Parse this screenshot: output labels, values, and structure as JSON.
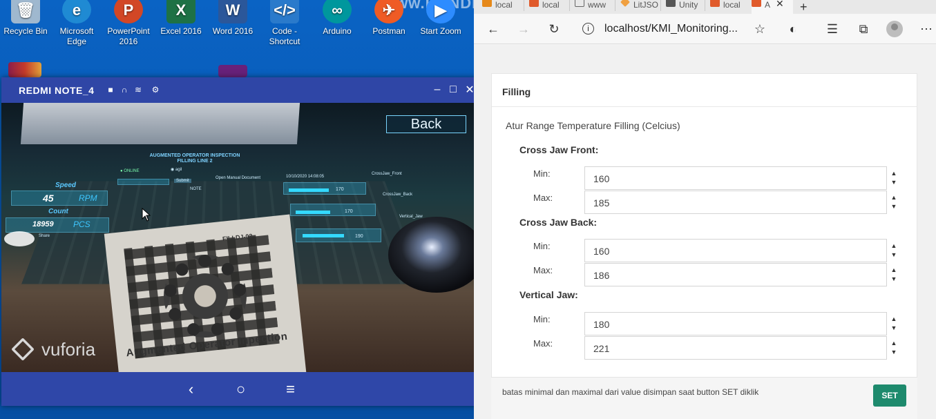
{
  "desktop": {
    "icons": [
      {
        "label": "Recycle Bin",
        "icon": "recycle-bin-icon",
        "color": "#9fb8cf"
      },
      {
        "label": "Microsoft Edge",
        "icon": "edge-icon",
        "color": "#1f8ad3"
      },
      {
        "label": "PowerPoint 2016",
        "icon": "powerpoint-icon",
        "color": "#d24726",
        "glyph": "P"
      },
      {
        "label": "Excel 2016",
        "icon": "excel-icon",
        "color": "#1e7145",
        "glyph": "X"
      },
      {
        "label": "Word 2016",
        "icon": "word-icon",
        "color": "#2b579a",
        "glyph": "W"
      },
      {
        "label": "Code - Shortcut",
        "icon": "vscode-icon",
        "color": "#2a7acb"
      },
      {
        "label": "Arduino",
        "icon": "arduino-icon",
        "color": "#00979d"
      },
      {
        "label": "Postman",
        "icon": "postman-icon",
        "color": "#ef5b25"
      },
      {
        "label": "Start Zoom",
        "icon": "zoom-icon",
        "color": "#2d8cff"
      }
    ],
    "watermark": "www.BANDICAM.com"
  },
  "phone_window": {
    "title": "REDMI NOTE_4",
    "back_label": "Back",
    "vuforia": "vuforia",
    "ar": {
      "title": "AUGMENTED OPERATOR INSPECTION",
      "subtitle": "FILLING LINE 2",
      "status": "ONLINE",
      "user": "agil",
      "submit": "Submit",
      "manual": "Open Manual Document",
      "note": "NOTE",
      "datetime": "10/10/2020 14:08:05",
      "speed_label": "Speed",
      "speed_value": "45",
      "speed_unit": "RPM",
      "count_label": "Count",
      "count_value": "18959",
      "count_unit": "PCS",
      "share": "Share",
      "temps": [
        "170",
        "170",
        "190"
      ],
      "callouts": [
        "CrossJaw_Front",
        "CrossJaw_Back",
        "Vertical_Jaw"
      ],
      "paper_caption": "Augmented Operator Inpection",
      "paper_tag": "FILLDJ-02"
    }
  },
  "browser": {
    "tabs": [
      {
        "label": "local",
        "fav_color": "#e6891a"
      },
      {
        "label": "local",
        "fav_color": "#e05a2b"
      },
      {
        "label": "www",
        "fav_color": "#666666"
      },
      {
        "label": "LitJSO",
        "fav_color": "#f0a040"
      },
      {
        "label": "Unity",
        "fav_color": "#555555"
      },
      {
        "label": "local",
        "fav_color": "#e05a2b"
      },
      {
        "label": "A",
        "fav_color": "#e05a2b"
      }
    ],
    "address": "localhost/KMI_Monitoring...",
    "card_title": "Filling",
    "section_title": "Atur Range Temperature Filling (Celcius)",
    "groups": [
      {
        "title": "Cross Jaw Front:",
        "min_label": "Min:",
        "min": "160",
        "max_label": "Max:",
        "max": "185"
      },
      {
        "title": "Cross Jaw Back:",
        "min_label": "Min:",
        "min": "160",
        "max_label": "Max:",
        "max": "186"
      },
      {
        "title": "Vertical Jaw:",
        "min_label": "Min:",
        "min": "180",
        "max_label": "Max:",
        "max": "221"
      }
    ],
    "footer_note": "batas minimal dan maximal dari value disimpan saat button SET diklik",
    "set_label": "SET",
    "accent": "#1e8a6d"
  }
}
